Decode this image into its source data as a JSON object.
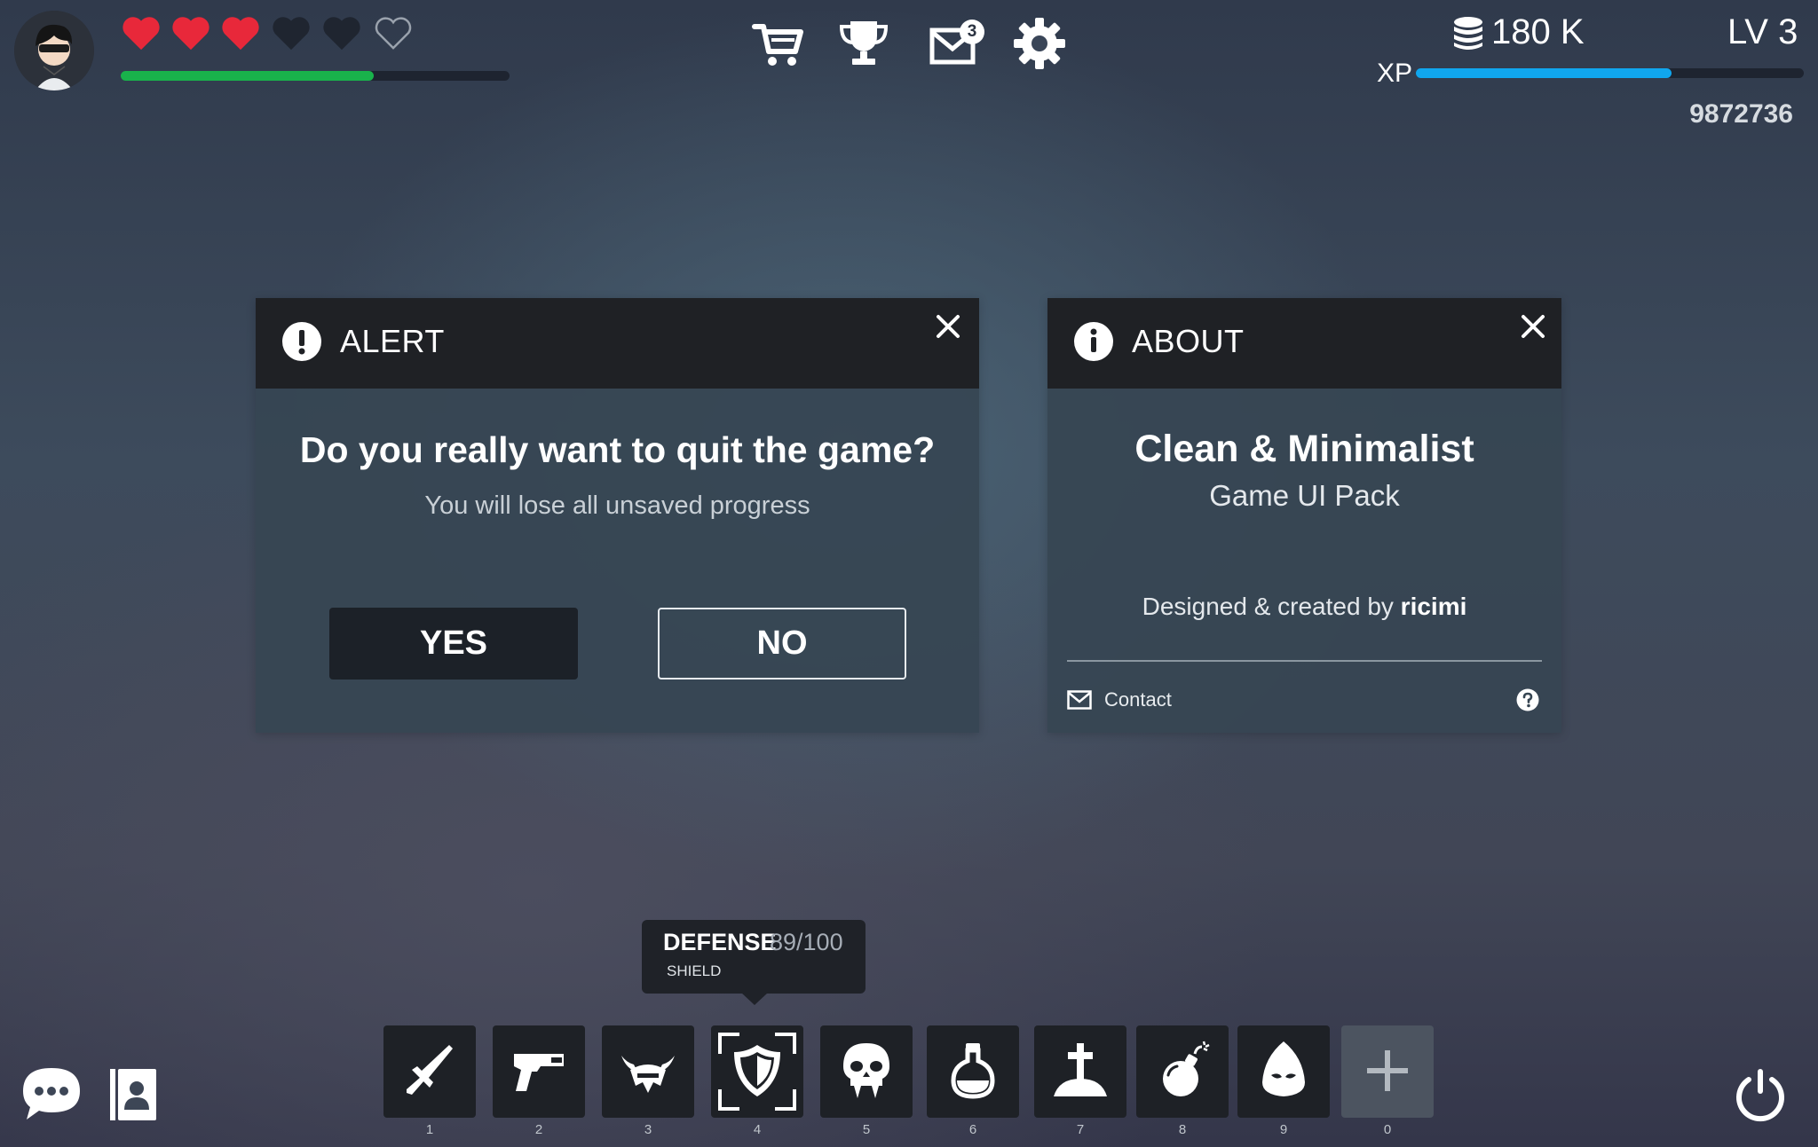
{
  "player": {
    "avatar_icon": "player-avatar",
    "hearts": [
      "full",
      "full",
      "full",
      "empty",
      "empty",
      "outline"
    ],
    "health_fraction": 0.65,
    "coins_label": "180 K",
    "level_label": "LV 3",
    "xp_label": "XP",
    "xp_fraction": 0.66,
    "score": "9872736"
  },
  "toolbar": {
    "icons": [
      "cart-icon",
      "trophy-icon",
      "mail-icon",
      "settings-icon"
    ],
    "mail_badge": "3"
  },
  "alert_dialog": {
    "title": "ALERT",
    "question": "Do you really want to quit the game?",
    "subtitle": "You will lose all unsaved progress",
    "yes_label": "YES",
    "no_label": "NO"
  },
  "about_dialog": {
    "title": "ABOUT",
    "product_name": "Clean & Minimalist",
    "product_sub": "Game UI Pack",
    "credit_prefix": "Designed & created by",
    "credit_author": "ricimi",
    "contact_label": "Contact"
  },
  "tooltip": {
    "title": "DEFENSE",
    "value": "89/100",
    "item": "SHIELD"
  },
  "hotbar": {
    "slots": [
      {
        "key": "1",
        "icon": "sword-icon"
      },
      {
        "key": "2",
        "icon": "pistol-icon"
      },
      {
        "key": "3",
        "icon": "horned-helmet-icon"
      },
      {
        "key": "4",
        "icon": "shield-icon",
        "selected": true
      },
      {
        "key": "5",
        "icon": "vampire-skull-icon"
      },
      {
        "key": "6",
        "icon": "potion-icon"
      },
      {
        "key": "7",
        "icon": "grave-icon"
      },
      {
        "key": "8",
        "icon": "bomb-icon"
      },
      {
        "key": "9",
        "icon": "hood-icon"
      },
      {
        "key": "0",
        "icon": "add-icon"
      }
    ]
  },
  "colors": {
    "heart_red": "#e8283a",
    "health_green": "#19b24b",
    "xp_blue": "#10a6ee",
    "dialog_header": "#1f2125"
  }
}
